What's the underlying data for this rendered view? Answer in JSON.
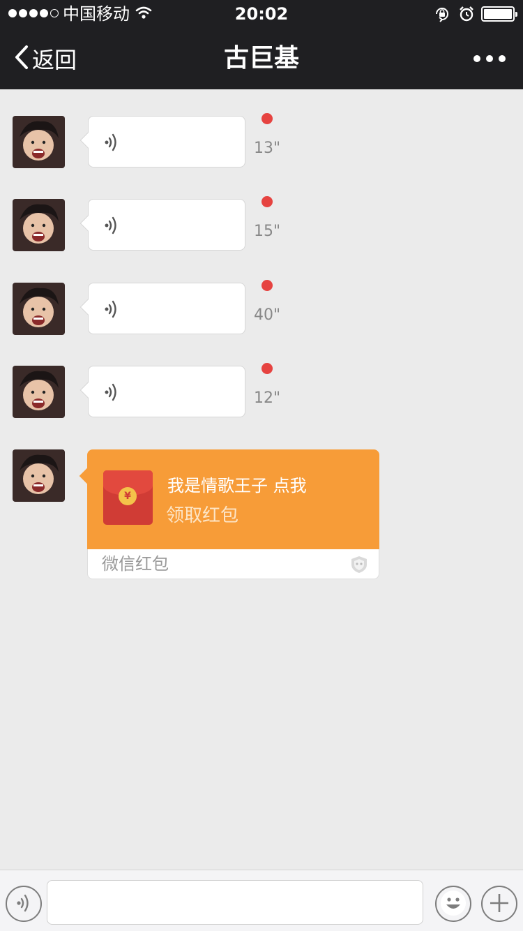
{
  "status_bar": {
    "carrier": "中国移动",
    "time": "20:02",
    "signal_bars_filled": 4,
    "signal_bars_total": 5,
    "battery_level": 1.0
  },
  "nav": {
    "back_label": "返回",
    "title": "古巨基"
  },
  "messages": [
    {
      "type": "voice",
      "duration": "13\"",
      "unread": true
    },
    {
      "type": "voice",
      "duration": "15\"",
      "unread": true
    },
    {
      "type": "voice",
      "duration": "40\"",
      "unread": true
    },
    {
      "type": "voice",
      "duration": "12\"",
      "unread": true
    },
    {
      "type": "red_packet",
      "title": "我是情歌王子 点我",
      "subtitle": "领取红包",
      "source": "微信红包",
      "coin_symbol": "¥"
    }
  ],
  "colors": {
    "bar_bg": "#1f1f22",
    "chat_bg": "#ebebeb",
    "unread": "#e64340",
    "red_packet": "#f79c38"
  },
  "input_bar": {
    "left_icon": "voice-icon",
    "right_icons": [
      "emoji-icon",
      "plus-icon"
    ]
  }
}
